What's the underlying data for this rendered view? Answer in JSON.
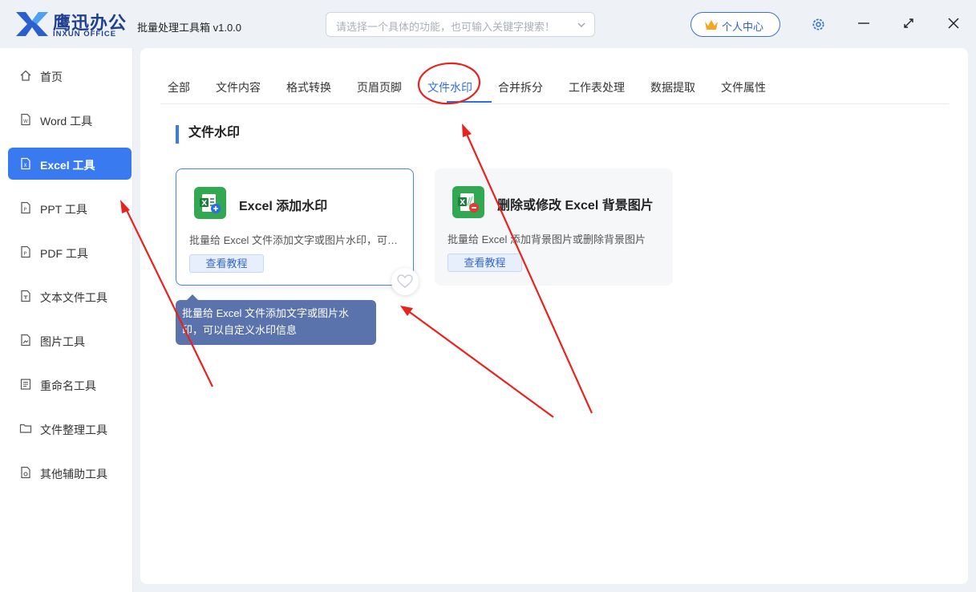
{
  "app": {
    "logo_cn": "鹰迅办公",
    "logo_en": "INXUN OFFICE",
    "title": "批量处理工具箱 v1.0.0"
  },
  "search": {
    "placeholder": "请选择一个具体的功能，也可输入关键字搜索！"
  },
  "header": {
    "user_center": "个人中心"
  },
  "sidebar": {
    "items": [
      {
        "label": "首页",
        "icon": "home-icon"
      },
      {
        "label": "Word 工具",
        "icon": "word-file-icon"
      },
      {
        "label": "Excel 工具",
        "icon": "excel-file-icon",
        "active": true
      },
      {
        "label": "PPT 工具",
        "icon": "ppt-file-icon"
      },
      {
        "label": "PDF 工具",
        "icon": "pdf-file-icon"
      },
      {
        "label": "文本文件工具",
        "icon": "text-file-icon"
      },
      {
        "label": "图片工具",
        "icon": "image-file-icon"
      },
      {
        "label": "重命名工具",
        "icon": "rename-icon"
      },
      {
        "label": "文件整理工具",
        "icon": "folder-icon"
      },
      {
        "label": "其他辅助工具",
        "icon": "misc-file-icon"
      }
    ]
  },
  "tabs": [
    {
      "label": "全部"
    },
    {
      "label": "文件内容"
    },
    {
      "label": "格式转换"
    },
    {
      "label": "页眉页脚"
    },
    {
      "label": "文件水印",
      "active": true
    },
    {
      "label": "合并拆分"
    },
    {
      "label": "工作表处理"
    },
    {
      "label": "数据提取"
    },
    {
      "label": "文件属性"
    }
  ],
  "section": {
    "title": "文件水印"
  },
  "cards": [
    {
      "title": "Excel 添加水印",
      "desc": "批量给 Excel 文件添加文字或图片水印，可以自定义水印信息",
      "button": "查看教程"
    },
    {
      "title": "删除或修改 Excel 背景图片",
      "desc": "批量给 Excel 添加背景图片或删除背景图片",
      "button": "查看教程"
    }
  ],
  "tooltip": {
    "line1": "批量给 Excel 文件添加文字或图片水",
    "line2": "印，可以自定义水印信息"
  },
  "colors": {
    "accent": "#3a7af0",
    "annotation": "#e8231f",
    "excel_green": "#32a853"
  }
}
